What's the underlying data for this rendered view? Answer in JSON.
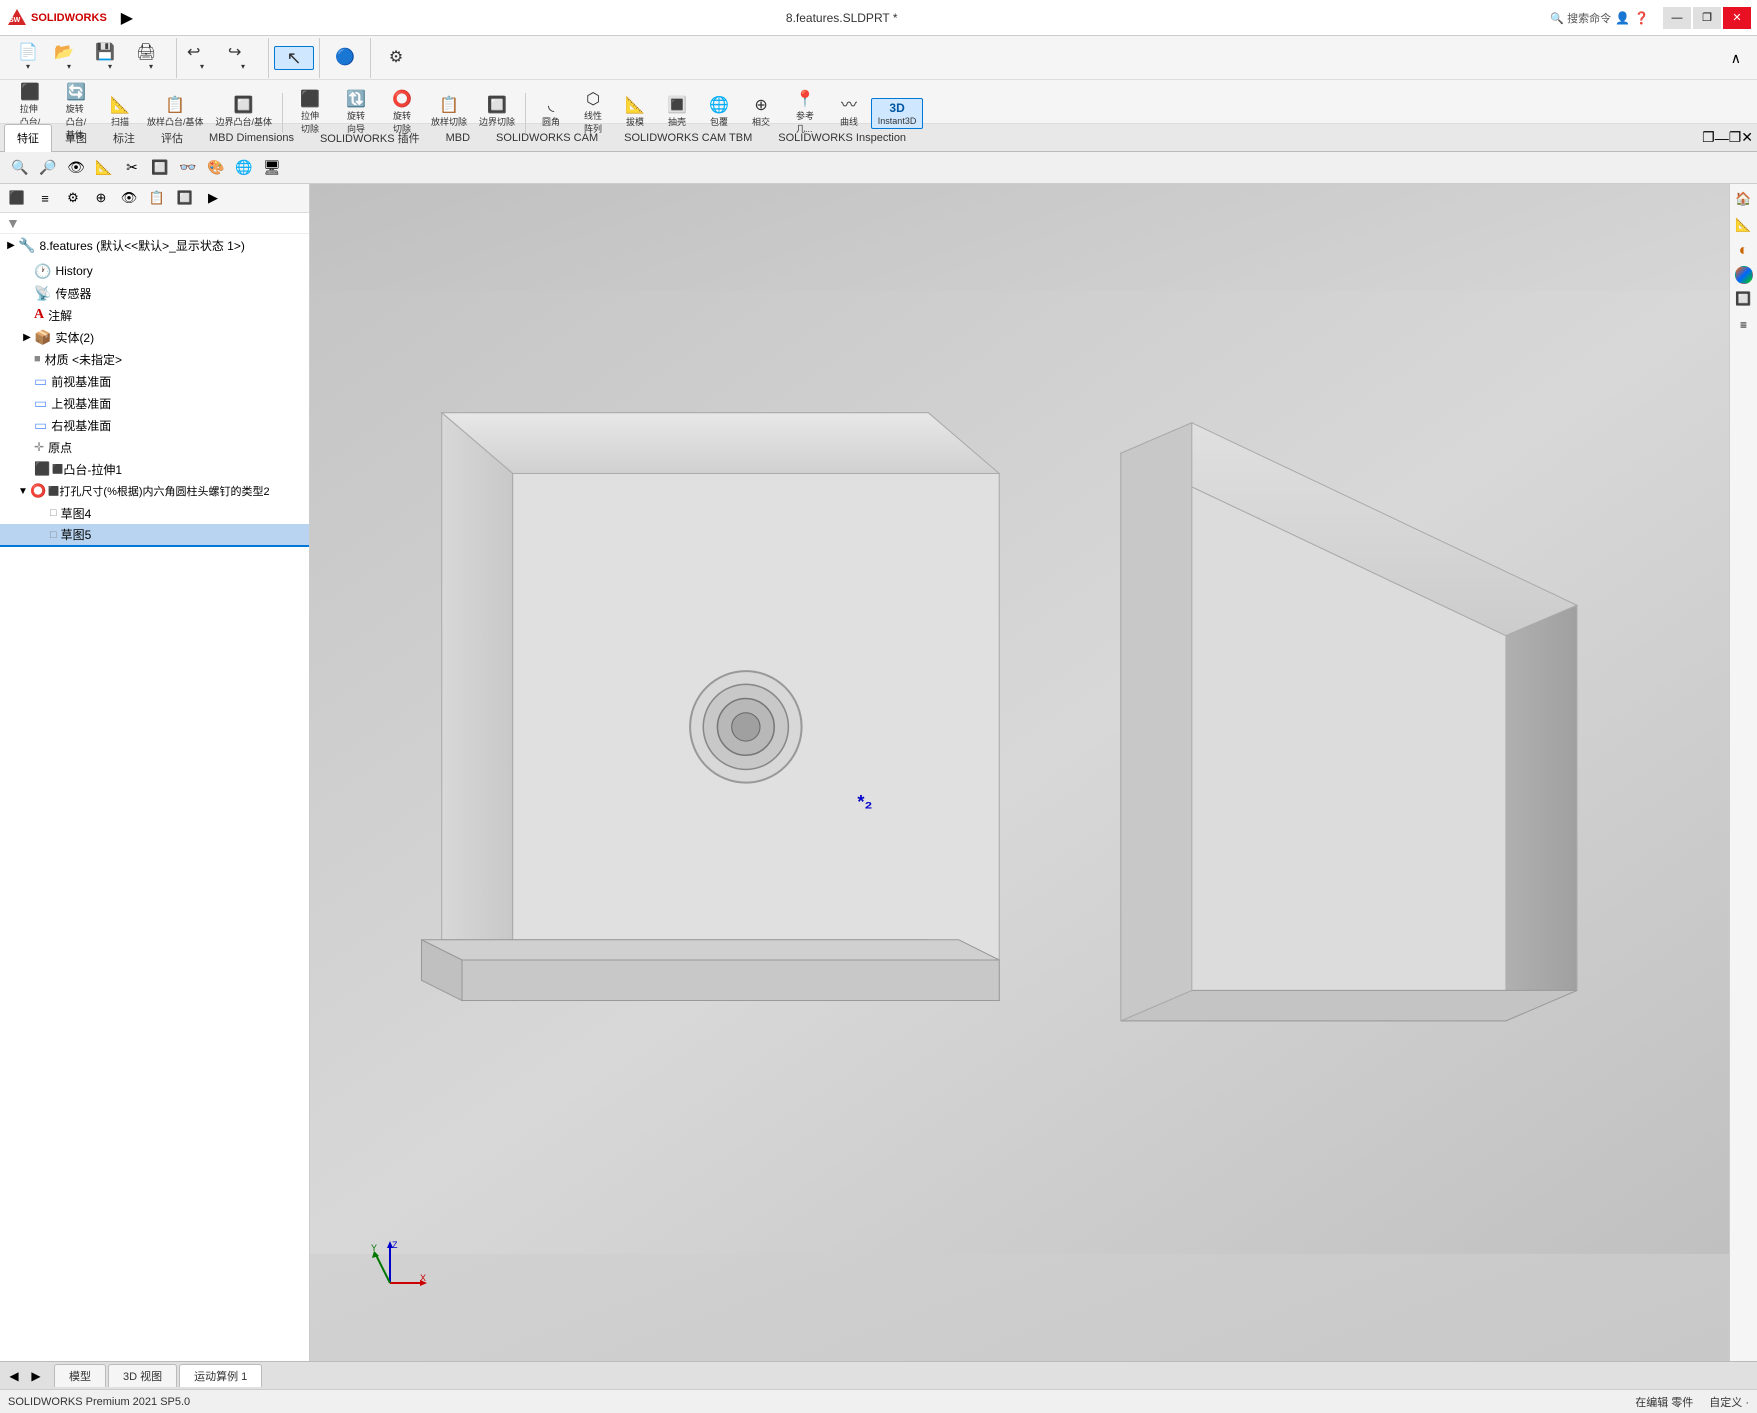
{
  "app": {
    "title": "SOLIDWORKS",
    "file_name": "8.features.SLDPRT *",
    "search_placeholder": "搜索命令",
    "logo_text": "SOLIDWORKS"
  },
  "title_bar": {
    "win_min": "—",
    "win_restore": "❐",
    "win_close": "✕",
    "win_min2": "—",
    "win_restore2": "❐",
    "win_close2": "✕"
  },
  "toolbar1": {
    "buttons": [
      {
        "id": "new",
        "icon": "📄",
        "label": ""
      },
      {
        "id": "open",
        "icon": "📂",
        "label": ""
      },
      {
        "id": "save",
        "icon": "💾",
        "label": ""
      },
      {
        "id": "print",
        "icon": "🖨",
        "label": ""
      },
      {
        "id": "undo",
        "icon": "↩",
        "label": ""
      },
      {
        "id": "redo",
        "icon": "↪",
        "label": ""
      },
      {
        "id": "select",
        "icon": "↖",
        "label": ""
      },
      {
        "id": "rebuild",
        "icon": "🔵",
        "label": ""
      },
      {
        "id": "options",
        "icon": "⚙",
        "label": ""
      }
    ]
  },
  "toolbar2": {
    "groups": [
      {
        "name": "extrude-group",
        "buttons": [
          {
            "id": "boss-extrude",
            "icon": "⬛",
            "label": "拉伸\n凸台/\n基体"
          },
          {
            "id": "revolve",
            "icon": "🔄",
            "label": "旋转\n凸台/\n基体"
          },
          {
            "id": "sweep",
            "icon": "📐",
            "label": "扫描"
          },
          {
            "id": "hole",
            "icon": "⭕",
            "label": "放样凸台/基体"
          },
          {
            "id": "boundary",
            "icon": "🔲",
            "label": "边界凸台/基体"
          }
        ]
      },
      {
        "name": "cut-group",
        "buttons": [
          {
            "id": "extrude-cut",
            "icon": "✂",
            "label": "拉伸\n切除"
          },
          {
            "id": "revolve-cut",
            "icon": "🔃",
            "label": "旋转\n向导"
          },
          {
            "id": "swept-cut",
            "icon": "✂",
            "label": "旋转\n切除"
          },
          {
            "id": "loft-cut",
            "icon": "📋",
            "label": "放样切除"
          },
          {
            "id": "boundary-cut",
            "icon": "🔲",
            "label": "边界切除"
          }
        ]
      },
      {
        "name": "feature-group",
        "buttons": [
          {
            "id": "fillet",
            "icon": "◟",
            "label": "圆角"
          },
          {
            "id": "chamfer",
            "icon": "⬡",
            "label": "线性\n阵列"
          },
          {
            "id": "draft",
            "icon": "📐",
            "label": "拔模"
          },
          {
            "id": "shell",
            "icon": "🔳",
            "label": "抽壳"
          },
          {
            "id": "wrap",
            "icon": "🌐",
            "label": "包覆"
          },
          {
            "id": "intersect",
            "icon": "⊕",
            "label": "相交"
          },
          {
            "id": "ref-geo",
            "icon": "📍",
            "label": "参考\n几..."
          },
          {
            "id": "curves",
            "icon": "〰",
            "label": "曲线"
          },
          {
            "id": "instant3d",
            "icon": "3D",
            "label": "Instant3D"
          }
        ]
      }
    ]
  },
  "tabs": [
    {
      "id": "features",
      "label": "特征",
      "active": true
    },
    {
      "id": "sketch",
      "label": "草图",
      "active": false
    },
    {
      "id": "markup",
      "label": "标注",
      "active": false
    },
    {
      "id": "evaluate",
      "label": "评估",
      "active": false
    },
    {
      "id": "mbd-dimensions",
      "label": "MBD Dimensions",
      "active": false
    },
    {
      "id": "solidworks-plugins",
      "label": "SOLIDWORKS 插件",
      "active": false
    },
    {
      "id": "mbd",
      "label": "MBD",
      "active": false
    },
    {
      "id": "sw-cam",
      "label": "SOLIDWORKS CAM",
      "active": false
    },
    {
      "id": "sw-cam-tbm",
      "label": "SOLIDWORKS CAM TBM",
      "active": false
    },
    {
      "id": "sw-inspection",
      "label": "SOLIDWORKS Inspection",
      "active": false
    }
  ],
  "icon_toolbar": {
    "icons": [
      "🔍",
      "🔎",
      "👁",
      "📐",
      "✂",
      "🔲",
      "👓",
      "🎨",
      "🌐",
      "🖥"
    ]
  },
  "feature_tree": {
    "root_label": "8.features (默认<<默认>_显示状态 1>)",
    "filter_icon": "▼",
    "items": [
      {
        "id": "history",
        "label": "History",
        "icon": "🕐",
        "depth": 1,
        "expandable": false,
        "selected": false
      },
      {
        "id": "sensors",
        "label": "传感器",
        "icon": "📡",
        "depth": 1,
        "expandable": false,
        "selected": false
      },
      {
        "id": "annotations",
        "label": "注解",
        "icon": "A",
        "depth": 1,
        "expandable": false,
        "selected": false
      },
      {
        "id": "solid-bodies",
        "label": "实体(2)",
        "icon": "📦",
        "depth": 1,
        "expandable": true,
        "selected": false
      },
      {
        "id": "material",
        "label": "材质 <未指定>",
        "icon": "🎨",
        "depth": 1,
        "expandable": false,
        "selected": false
      },
      {
        "id": "front-plane",
        "label": "前视基准面",
        "icon": "▭",
        "depth": 1,
        "expandable": false,
        "selected": false
      },
      {
        "id": "top-plane",
        "label": "上视基准面",
        "icon": "▭",
        "depth": 1,
        "expandable": false,
        "selected": false
      },
      {
        "id": "right-plane",
        "label": "右视基准面",
        "icon": "▭",
        "depth": 1,
        "expandable": false,
        "selected": false
      },
      {
        "id": "origin",
        "label": "原点",
        "icon": "✛",
        "depth": 1,
        "expandable": false,
        "selected": false
      },
      {
        "id": "boss-extrude1",
        "label": "凸台-拉伸1",
        "icon": "⬛",
        "depth": 1,
        "expandable": false,
        "selected": false
      },
      {
        "id": "hole-wizard1",
        "label": "打孔尺寸(%根据)内六角圆柱头螺钉的类型2",
        "icon": "⭕",
        "depth": 1,
        "expandable": true,
        "selected": false
      },
      {
        "id": "sketch4",
        "label": "草图4",
        "icon": "□",
        "depth": 2,
        "expandable": false,
        "selected": false
      },
      {
        "id": "sketch5",
        "label": "草图5",
        "icon": "□",
        "depth": 2,
        "expandable": false,
        "selected": true
      }
    ]
  },
  "viewport": {
    "marker": "*₂"
  },
  "right_panel": {
    "buttons": [
      "🏠",
      "📐",
      "🔄",
      "🌈",
      "🔲",
      "📋"
    ]
  },
  "bottom_tabs": [
    {
      "id": "model",
      "label": "模型",
      "active": false
    },
    {
      "id": "3d-view",
      "label": "3D 视图",
      "active": false
    },
    {
      "id": "motion",
      "label": "运动算例 1",
      "active": true
    }
  ],
  "status_bar": {
    "left": "SOLIDWORKS Premium 2021 SP5.0",
    "middle": "在编辑 零件",
    "right": "自定义 ·"
  }
}
